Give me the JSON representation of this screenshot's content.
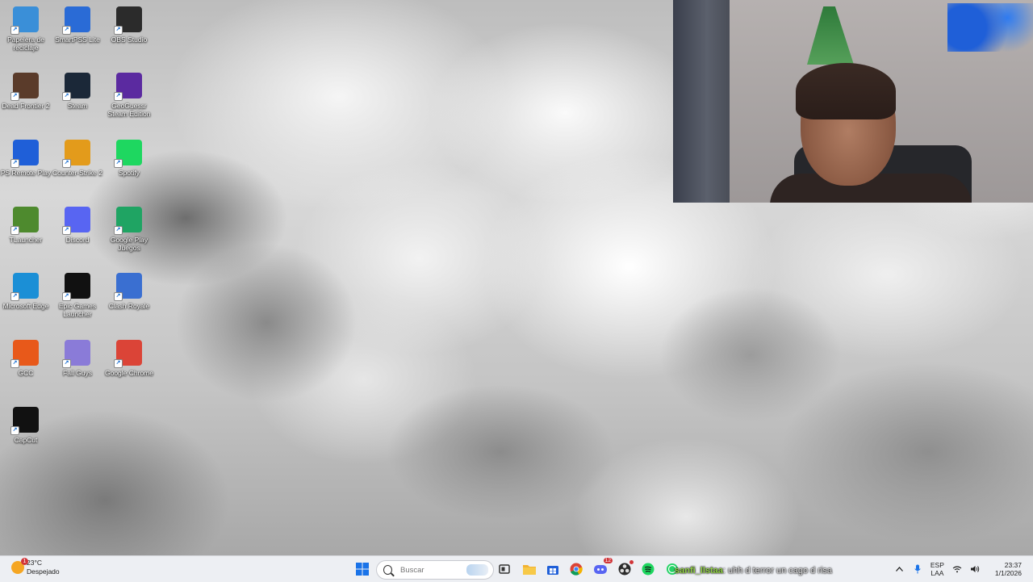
{
  "desktop_icons": [
    {
      "label": "Papelera de reciclaje",
      "icon": "recycle-bin-icon",
      "color": "#3a8fd8"
    },
    {
      "label": "SmartPSS Lite",
      "icon": "smartpss-icon",
      "color": "#2a6bd6"
    },
    {
      "label": "OBS Studio",
      "icon": "obs-icon",
      "color": "#2b2b2b"
    },
    {
      "label": "Dead Frontier 2",
      "icon": "dead-frontier-icon",
      "color": "#5a3b2a"
    },
    {
      "label": "Steam",
      "icon": "steam-icon",
      "color": "#1b2838"
    },
    {
      "label": "GeoGuessr Steam Edition",
      "icon": "geoguessr-icon",
      "color": "#5b2aa0"
    },
    {
      "label": "PS Remote Play",
      "icon": "ps-remote-play-icon",
      "color": "#1f5fd8"
    },
    {
      "label": "Counter-Strike 2",
      "icon": "counter-strike-icon",
      "color": "#e39b1b"
    },
    {
      "label": "Spotify",
      "icon": "spotify-icon",
      "color": "#1ed760"
    },
    {
      "label": "TLauncher",
      "icon": "tlauncher-icon",
      "color": "#4e8a2e"
    },
    {
      "label": "Discord",
      "icon": "discord-icon",
      "color": "#5865f2"
    },
    {
      "label": "Google Play Juegos",
      "icon": "google-play-games-icon",
      "color": "#1fa463"
    },
    {
      "label": "Microsoft Edge",
      "icon": "edge-icon",
      "color": "#1b8fd6"
    },
    {
      "label": "Epic Games Launcher",
      "icon": "epic-games-icon",
      "color": "#111111"
    },
    {
      "label": "Clash Royale",
      "icon": "clash-royale-icon",
      "color": "#3a6fd1"
    },
    {
      "label": "GCC",
      "icon": "gcc-icon",
      "color": "#e8591a"
    },
    {
      "label": "Fall Guys",
      "icon": "fall-guys-icon",
      "color": "#8a7bd8"
    },
    {
      "label": "Google Chrome",
      "icon": "chrome-icon",
      "color": "#db4437"
    },
    {
      "label": "CapCut",
      "icon": "capcut-icon",
      "color": "#111111"
    }
  ],
  "taskbar": {
    "weather_temp": "23°C",
    "weather_desc": "Despejado",
    "weather_badge": "1",
    "search_placeholder": "Buscar",
    "chat_user": "sanfi_llstaa",
    "chat_message": ": uhh d terror un cago d risa",
    "lang_top": "ESP",
    "lang_bottom": "LAA",
    "time": "23:37",
    "date": "1/1/2026",
    "discord_badge": "12",
    "apps": [
      {
        "name": "start-button",
        "icon": "windows-icon",
        "color": "#1a73e8"
      },
      {
        "name": "task-view-button",
        "icon": "task-view-icon",
        "color": "#333333"
      },
      {
        "name": "file-explorer-button",
        "icon": "folder-icon",
        "color": "#f2b233"
      },
      {
        "name": "store-button",
        "icon": "store-icon",
        "color": "#1f5fd8"
      },
      {
        "name": "chrome-button",
        "icon": "chrome-icon",
        "color": "#db4437"
      },
      {
        "name": "discord-button",
        "icon": "discord-icon",
        "color": "#5865f2"
      },
      {
        "name": "obs-button",
        "icon": "obs-icon",
        "color": "#2b2b2b"
      },
      {
        "name": "spotify-button",
        "icon": "spotify-icon",
        "color": "#1ed760"
      },
      {
        "name": "whatsapp-button",
        "icon": "whatsapp-icon",
        "color": "#25d366"
      }
    ]
  }
}
